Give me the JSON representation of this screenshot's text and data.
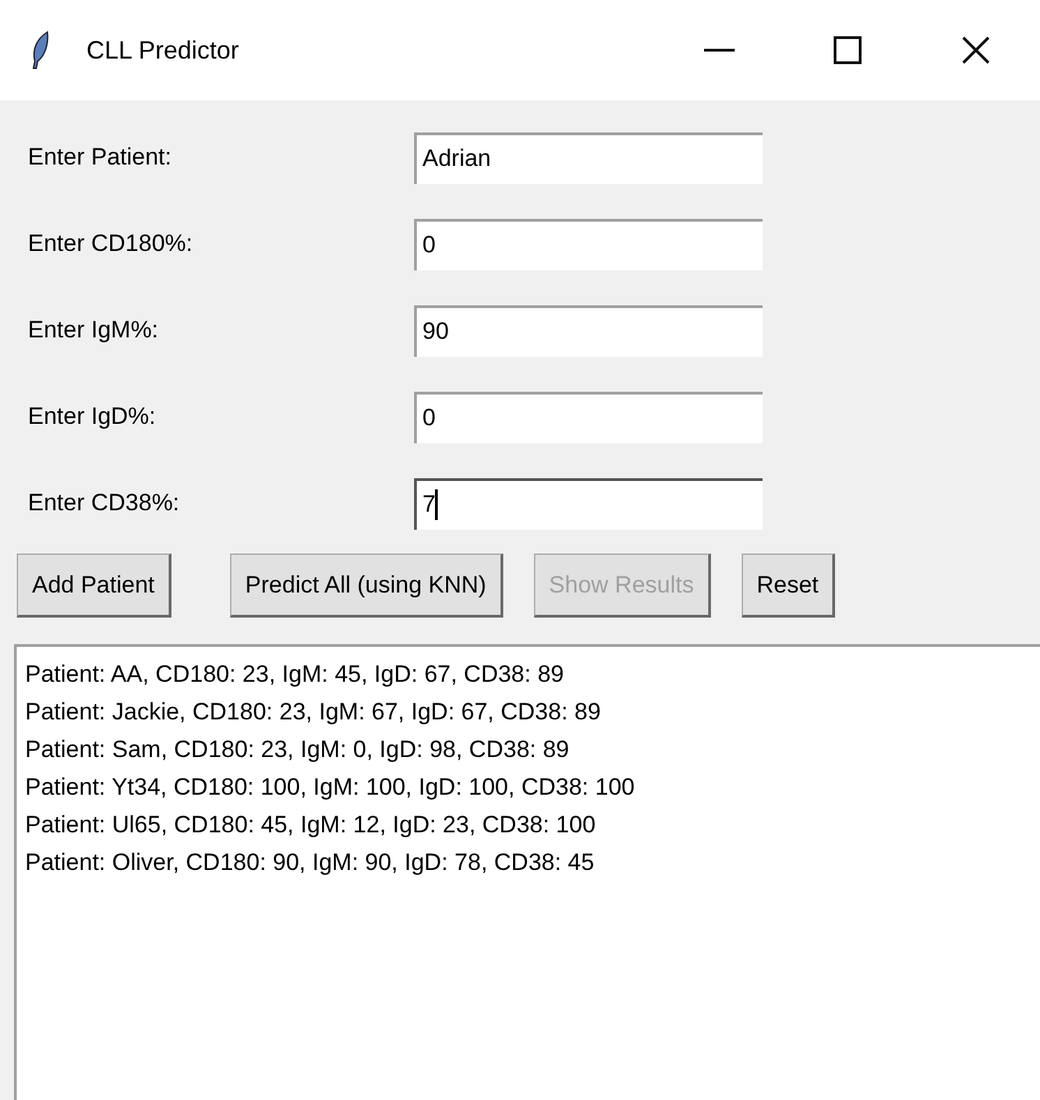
{
  "window": {
    "title": "CLL Predictor"
  },
  "fields": [
    {
      "label": "Enter Patient:",
      "value": "Adrian",
      "focused": false
    },
    {
      "label": "Enter CD180%:",
      "value": "0",
      "focused": false
    },
    {
      "label": "Enter IgM%:",
      "value": "90",
      "focused": false
    },
    {
      "label": "Enter IgD%:",
      "value": "0",
      "focused": false
    },
    {
      "label": "Enter CD38%:",
      "value": "7",
      "focused": true
    }
  ],
  "buttons": [
    {
      "label": "Add Patient",
      "disabled": false
    },
    {
      "label": "Predict All (using KNN)",
      "disabled": false
    },
    {
      "label": "Show Results",
      "disabled": true
    },
    {
      "label": "Reset",
      "disabled": false
    }
  ],
  "patients": [
    "Patient: AA, CD180: 23, IgM: 45, IgD: 67, CD38: 89",
    "Patient: Jackie, CD180: 23, IgM: 67, IgD: 67, CD38: 89",
    "Patient: Sam, CD180: 23, IgM: 0, IgD: 98, CD38: 89",
    "Patient: Yt34, CD180: 100, IgM: 100, IgD: 100, CD38: 100",
    "Patient: Ul65, CD180: 45, IgM: 12, IgD: 23, CD38: 100",
    "Patient: Oliver, CD180: 90, IgM: 90, IgD: 78, CD38: 45"
  ]
}
